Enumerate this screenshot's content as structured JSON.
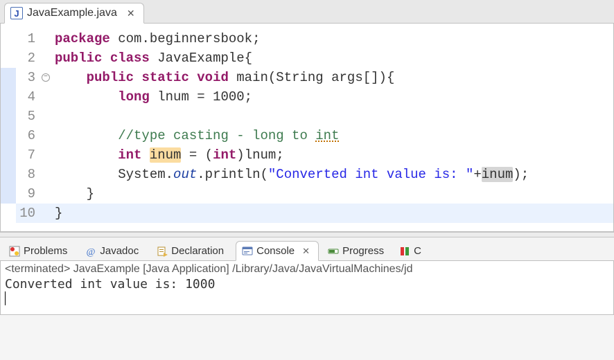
{
  "editor_tab": {
    "filename": "JavaExample.java"
  },
  "code": {
    "lines": {
      "l1_package": "package",
      "l1_pkgname": "com.beginnersbook",
      "l2_public": "public",
      "l2_class": "class",
      "l2_name": "JavaExample",
      "l3_public": "public",
      "l3_static": "static",
      "l3_void": "void",
      "l3_main": "main",
      "l3_String": "String",
      "l3_args": "args",
      "l4_long": "long",
      "l4_var": "lnum",
      "l4_eq": "=",
      "l4_val": "1000",
      "l6_comment": "//type casting - long to ",
      "l6_int_squiggle": "int",
      "l7_int": "int",
      "l7_var": "inum",
      "l7_eq": "=",
      "l7_cast_open": "(",
      "l7_cast_type": "int",
      "l7_cast_close": ")",
      "l7_rhs": "lnum",
      "l8_System": "System",
      "l8_out": "out",
      "l8_println": "println",
      "l8_str": "\"Converted int value is: \"",
      "l8_plus": "+",
      "l8_var": "inum"
    },
    "line_numbers": [
      "1",
      "2",
      "3",
      "4",
      "5",
      "6",
      "7",
      "8",
      "9",
      "10"
    ]
  },
  "bottom_tabs": {
    "problems": "Problems",
    "javadoc": "Javadoc",
    "declaration": "Declaration",
    "console": "Console",
    "progress": "Progress"
  },
  "console": {
    "status": "<terminated> JavaExample [Java Application] /Library/Java/JavaVirtualMachines/jd",
    "output": "Converted int value is: 1000"
  }
}
